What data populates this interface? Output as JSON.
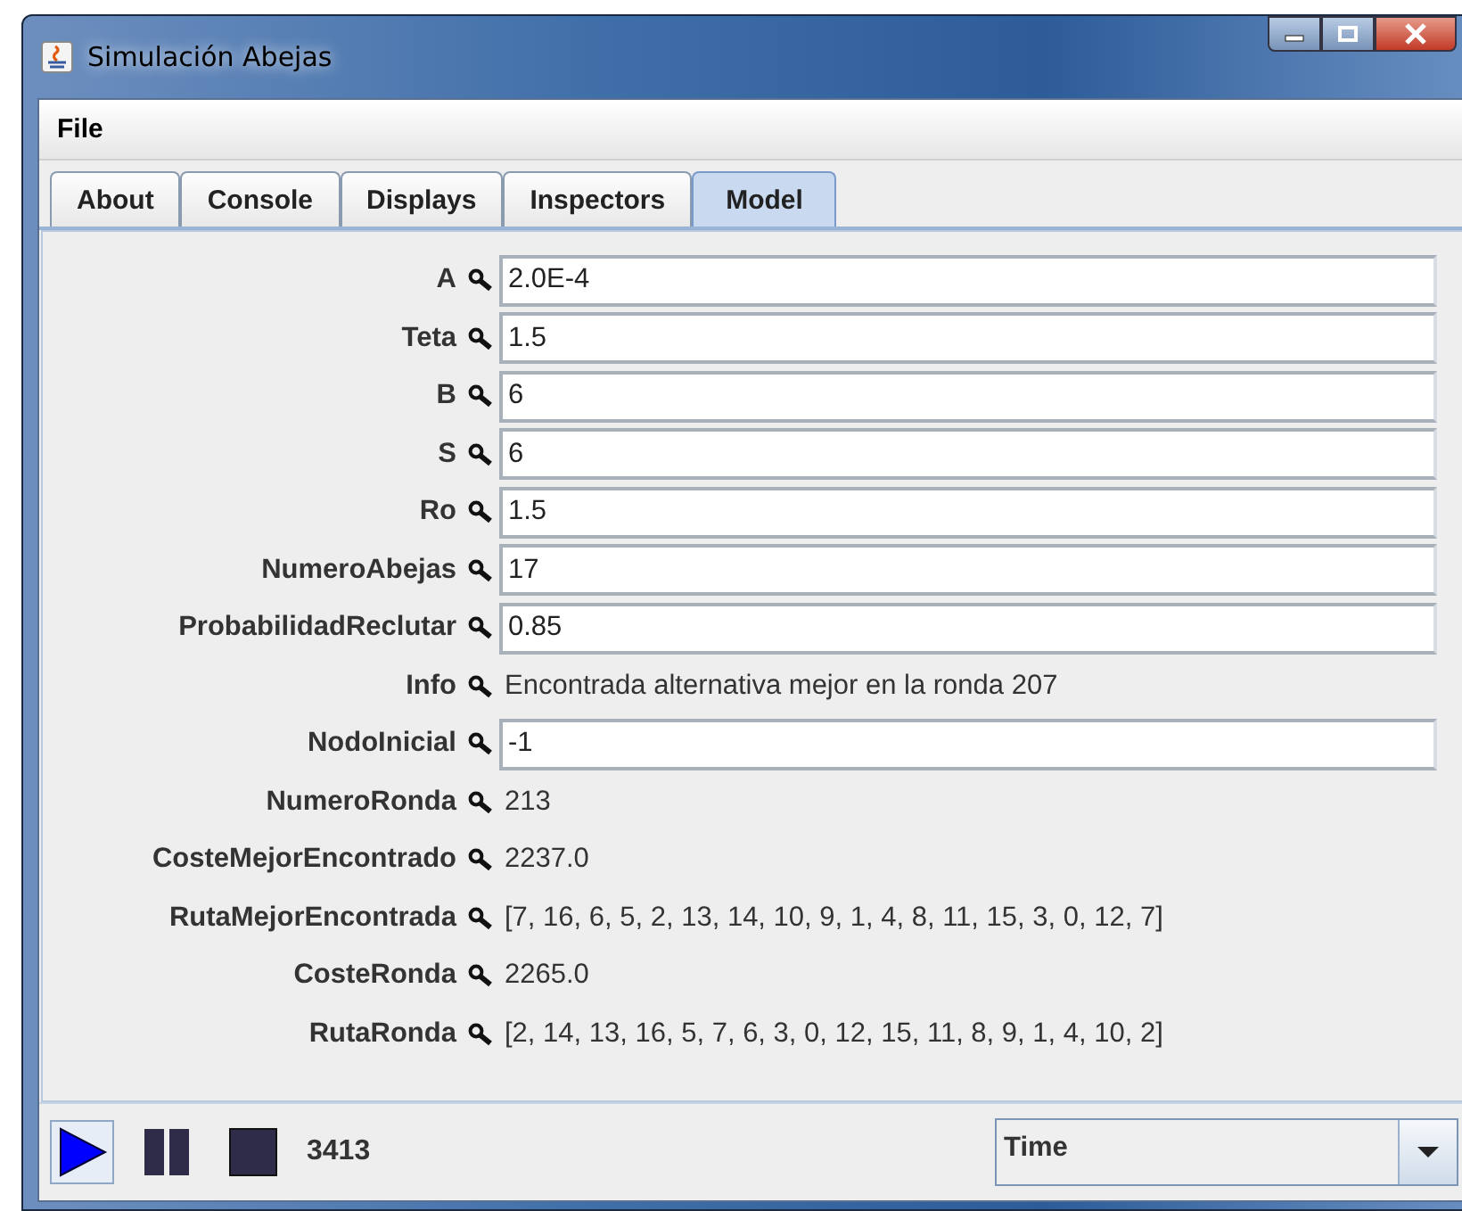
{
  "window": {
    "title": "Simulación Abejas"
  },
  "menu": [
    "File"
  ],
  "tabs": [
    {
      "label": "About",
      "selected": false
    },
    {
      "label": "Console",
      "selected": false
    },
    {
      "label": "Displays",
      "selected": false
    },
    {
      "label": "Inspectors",
      "selected": false
    },
    {
      "label": "Model",
      "selected": true
    }
  ],
  "properties": [
    {
      "label": "A",
      "kind": "field",
      "value": "2.0E-4"
    },
    {
      "label": "Teta",
      "kind": "field",
      "value": "1.5"
    },
    {
      "label": "B",
      "kind": "field",
      "value": "6"
    },
    {
      "label": "S",
      "kind": "field",
      "value": "6"
    },
    {
      "label": "Ro",
      "kind": "field",
      "value": "1.5"
    },
    {
      "label": "NumeroAbejas",
      "kind": "field",
      "value": "17"
    },
    {
      "label": "ProbabilidadReclutar",
      "kind": "field",
      "value": "0.85"
    },
    {
      "label": "Info",
      "kind": "text",
      "value": "Encontrada alternativa mejor en la ronda 207"
    },
    {
      "label": "NodoInicial",
      "kind": "field",
      "value": "-1"
    },
    {
      "label": "NumeroRonda",
      "kind": "text",
      "value": "213"
    },
    {
      "label": "CosteMejorEncontrado",
      "kind": "text",
      "value": "2237.0"
    },
    {
      "label": "RutaMejorEncontrada",
      "kind": "text",
      "value": "[7, 16, 6, 5, 2, 13, 14, 10, 9, 1, 4, 8, 11, 15, 3, 0, 12, 7]"
    },
    {
      "label": "CosteRonda",
      "kind": "text",
      "value": "2265.0"
    },
    {
      "label": "RutaRonda",
      "kind": "text",
      "value": "[2, 14, 13, 16, 5, 7, 6, 3, 0, 12, 15, 11, 8, 9, 1, 4, 10, 2]"
    }
  ],
  "controls": [
    {
      "kind": "play",
      "selected": true
    },
    {
      "kind": "pause",
      "selected": false
    },
    {
      "kind": "stop",
      "selected": false
    }
  ],
  "step_count": "3413",
  "time_select": {
    "value": "Time"
  }
}
